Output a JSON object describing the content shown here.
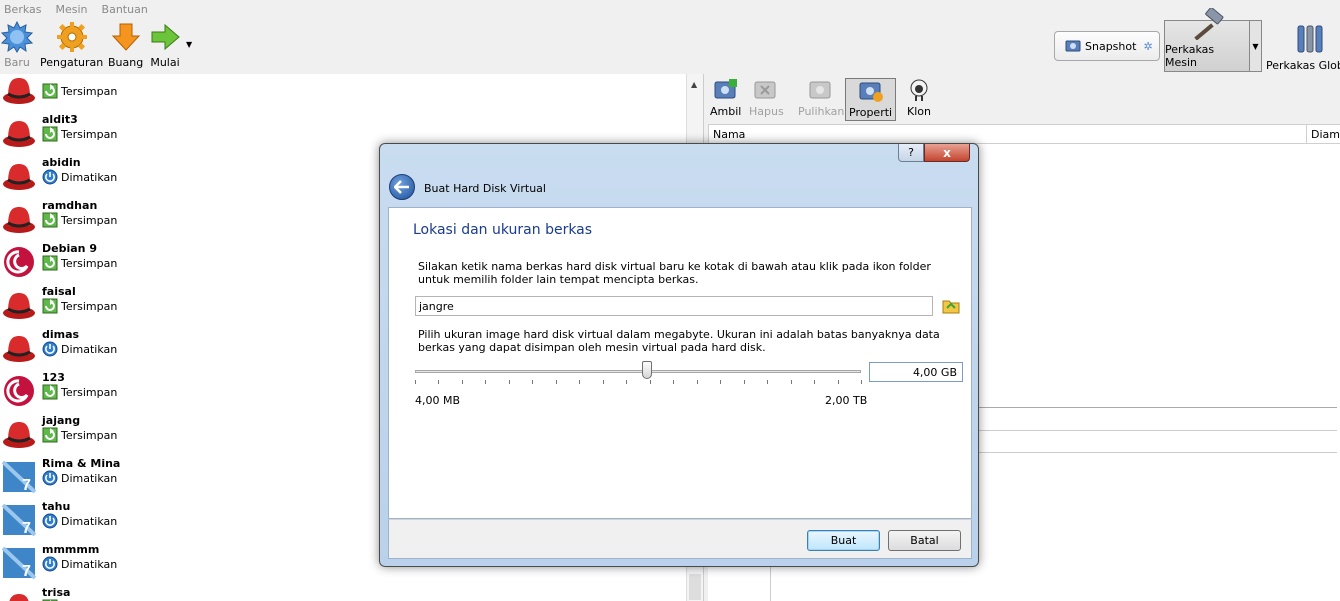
{
  "menubar": {
    "items": [
      "Berkas",
      "Mesin",
      "Bantuan"
    ]
  },
  "toolbar": {
    "baru": "Baru",
    "pengaturan": "Pengaturan",
    "buang": "Buang",
    "mulai": "Mulai",
    "snapshot": "Snapshot",
    "perkakas_mesin": "Perkakas Mesin",
    "perkakas_global": "Perkakas Global"
  },
  "vms": [
    {
      "name": "",
      "state": "Tersimpan",
      "os": "redhat"
    },
    {
      "name": "aldit3",
      "state": "Tersimpan",
      "os": "redhat"
    },
    {
      "name": "abidin",
      "state": "Dimatikan",
      "os": "redhat"
    },
    {
      "name": "ramdhan",
      "state": "Tersimpan",
      "os": "redhat"
    },
    {
      "name": "Debian 9",
      "state": "Tersimpan",
      "os": "debian"
    },
    {
      "name": "faisal",
      "state": "Tersimpan",
      "os": "redhat"
    },
    {
      "name": "dimas",
      "state": "Dimatikan",
      "os": "redhat"
    },
    {
      "name": "123",
      "state": "Tersimpan",
      "os": "debian"
    },
    {
      "name": "jajang",
      "state": "Tersimpan",
      "os": "redhat"
    },
    {
      "name": "Rima & Mina",
      "state": "Dimatikan",
      "os": "win7"
    },
    {
      "name": "tahu",
      "state": "Dimatikan",
      "os": "win7"
    },
    {
      "name": "mmmmm",
      "state": "Dimatikan",
      "os": "win7"
    },
    {
      "name": "trisa",
      "state": "Tersimpan",
      "os": "redhat"
    }
  ],
  "snapshot_toolbar": {
    "ambil": "Ambil",
    "hapus": "Hapus",
    "pulihkan": "Pulihkan",
    "properti": "Properti",
    "klon": "Klon"
  },
  "snapshot_table": {
    "col_name": "Nama",
    "col_other": "Diam"
  },
  "dialog": {
    "title": "Buat Hard Disk Virtual",
    "help": "?",
    "close": "x",
    "section_title": "Lokasi dan ukuran berkas",
    "desc1": "Silakan ketik nama berkas hard disk virtual baru ke kotak di bawah atau klik pada ikon folder untuk memilih folder lain tempat mencipta berkas.",
    "filename": "jangre",
    "desc2": "Pilih ukuran image hard disk virtual dalam megabyte. Ukuran ini adalah batas banyaknya data berkas yang dapat disimpan oleh mesin virtual pada hard disk.",
    "size_value": "4,00 GB",
    "slider_position": 0.52,
    "min_label": "4,00 MB",
    "max_label": "2,00 TB",
    "create_button": "Buat",
    "cancel_button": "Batal"
  }
}
